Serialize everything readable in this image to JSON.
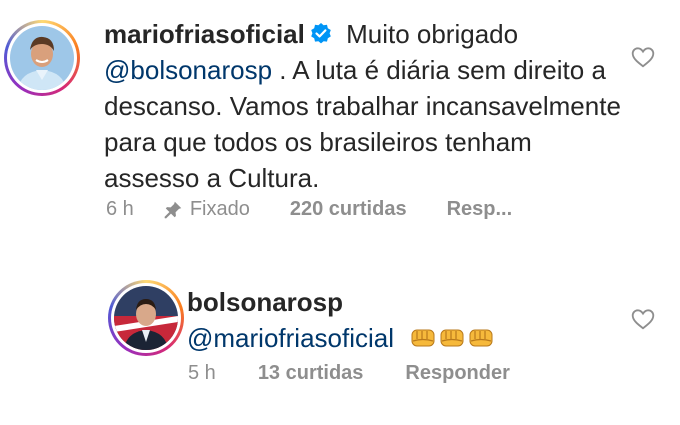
{
  "comments": [
    {
      "username": "mariofriasoficial",
      "text_part1": " Muito obrigado ",
      "mention": "@bolsonarosp",
      "text_part2": " . A luta é diária sem direito a descanso. Vamos trabalhar incansavelmente para que todos os brasileiros tenham assesso a Cultura.",
      "time": "6 h",
      "pinned_label": "Fixado",
      "likes": "220 curtidas",
      "reply": "Resp..."
    },
    {
      "username": "bolsonarosp",
      "mention": "@mariofriasoficial",
      "time": "5 h",
      "likes": "13 curtidas",
      "reply": "Responder"
    }
  ],
  "icons": {
    "verified": "verified-badge-icon",
    "pin": "pin-icon",
    "heart": "heart-outline-icon",
    "emoji": "oncoming-fist-emoji"
  },
  "colors": {
    "text": "#262626",
    "muted": "#8e8e8e",
    "mention": "#00376b",
    "verified": "#0095f6"
  }
}
